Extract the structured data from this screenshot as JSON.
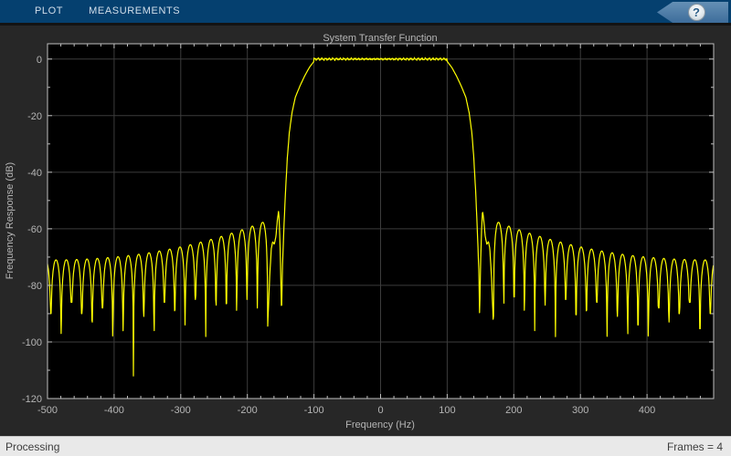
{
  "toolbar": {
    "tabs": [
      {
        "label": "PLOT"
      },
      {
        "label": "MEASUREMENTS"
      }
    ],
    "help_label": "?"
  },
  "status_bar": {
    "left": "Processing",
    "right": "Frames = 4"
  },
  "colors": {
    "toolbar_blue": "#05406f",
    "figure_background": "#272727",
    "axes_background": "#000000",
    "grid": "#3c3c3c",
    "axis_line": "#bfbfbf",
    "label_text": "#b5b5b5",
    "curve": "#ffff00",
    "status_bg": "#e9e9e9"
  },
  "chart_data": {
    "type": "line",
    "title": "System Transfer Function",
    "xlabel": "Frequency (Hz)",
    "ylabel": "Frequency Response (dB)",
    "xlim": [
      -500,
      500
    ],
    "ylim": [
      -120,
      5.4
    ],
    "x_ticks": [
      -500,
      -400,
      -300,
      -200,
      -100,
      0,
      100,
      200,
      300,
      400
    ],
    "y_ticks": [
      0,
      -20,
      -40,
      -60,
      -80,
      -100,
      -120
    ],
    "x_minor_step": 20,
    "y_minor_step": 10,
    "grid": true,
    "legend": "none",
    "series": [
      {
        "name": "System Transfer Function",
        "color": "#ffff00",
        "description": "Symmetric lowpass FIR magnitude response: flat 0 dB passband from -100 to 100 Hz with ~0.5 dB noise ripple, steep transition band reaching -91 dB notch near ±149 Hz, last sidelobe peak -53.5 dB at ±153 Hz, then periodic stopband sidelobes (period ~15.5 Hz) whose peaks decay from about -57 dB to -71 dB at ±500 Hz, with nulls between -85 and -112 dB (deepest near ±375 Hz)."
      }
    ],
    "key_points": [
      {
        "label": "passband level",
        "f_hz": 0,
        "db": 0
      },
      {
        "label": "passband edge",
        "f_hz": 100,
        "db": -0.8
      },
      {
        "label": "transition notch",
        "f_hz": 149,
        "db": -91
      },
      {
        "label": "first sidelobe peak",
        "f_hz": 153,
        "db": -53.5
      },
      {
        "label": "deepest stopband null",
        "f_hz": 371,
        "db": -112
      },
      {
        "label": "sidelobe level at band edge",
        "f_hz": 500,
        "db": -71
      }
    ],
    "synthesis": {
      "flat_edge": 100,
      "ripple_terms": [
        [
          0.2,
          1.13,
          0.7
        ],
        [
          0.16,
          2.71,
          2.1
        ],
        [
          0.12,
          5.77,
          4.2
        ],
        [
          0.08,
          9.3,
          1.1
        ]
      ],
      "transition_points": [
        [
          100,
          -0.8
        ],
        [
          107,
          -3
        ],
        [
          114,
          -6
        ],
        [
          121,
          -9.5
        ],
        [
          128,
          -13.5
        ],
        [
          133,
          -19
        ],
        [
          137,
          -26
        ],
        [
          140,
          -35
        ],
        [
          143,
          -48
        ],
        [
          145.5,
          -62
        ],
        [
          147.5,
          -75
        ],
        [
          148.7,
          -91
        ],
        [
          150,
          -74
        ],
        [
          151.5,
          -61
        ],
        [
          153,
          -53.5
        ],
        [
          155,
          -57
        ],
        [
          157,
          -62.5
        ],
        [
          159.5,
          -65.5
        ],
        [
          162,
          -64.5
        ],
        [
          164,
          -67
        ],
        [
          166.5,
          -77
        ],
        [
          168,
          -86
        ],
        [
          169.5,
          -95
        ]
      ],
      "stopband_start": 169.5,
      "lobe_period": 15.5,
      "env_far": -71,
      "env_rise": 14,
      "env_span": 330.5,
      "env_exp": 2.2,
      "null_depths": [
        -95,
        -88,
        -85,
        -92,
        -99,
        -87,
        -101,
        -85,
        -94,
        -89,
        -86,
        -98,
        -91,
        -112,
        -96,
        -102,
        -88,
        -93,
        -90,
        -86,
        -97,
        -90
      ],
      "sample_step_hz": 0.6
    }
  }
}
